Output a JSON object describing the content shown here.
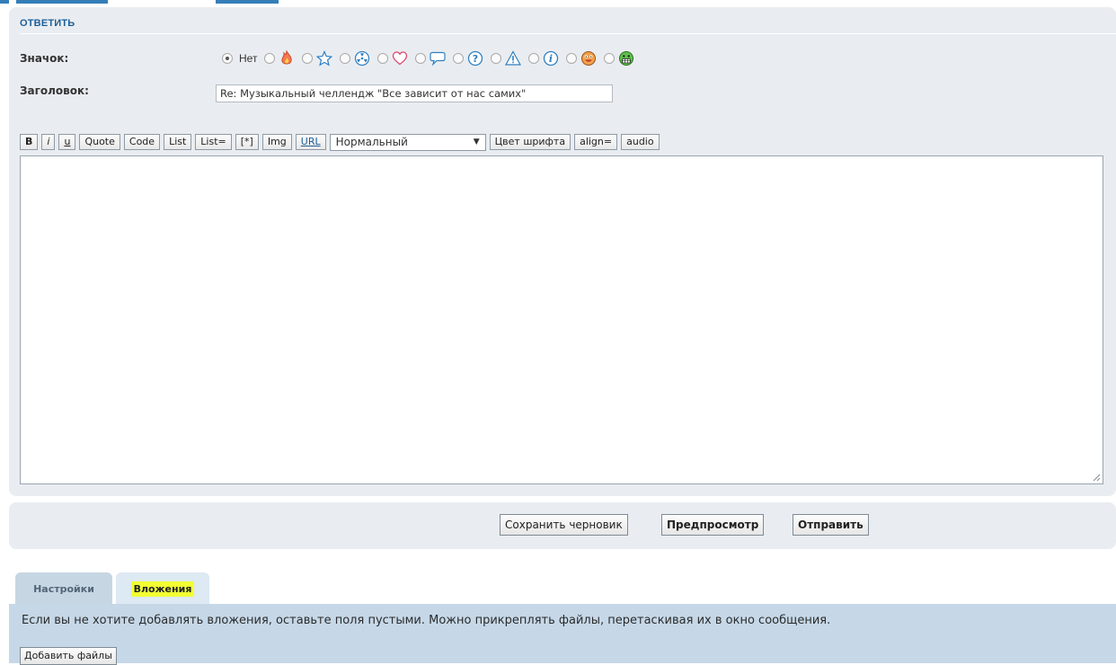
{
  "reply": {
    "title": "ОТВЕТИТЬ",
    "icon_label": "Значок:",
    "subject_label": "Заголовок:",
    "subject_value": "Re: Музыкальный челлендж \"Все зависит от нас самих\"",
    "icon_options": [
      {
        "label": "Нет",
        "icon": "none",
        "checked": true
      },
      {
        "label": "",
        "icon": "fire-icon",
        "checked": false
      },
      {
        "label": "",
        "icon": "star-icon",
        "checked": false
      },
      {
        "label": "",
        "icon": "radioactive-icon",
        "checked": false
      },
      {
        "label": "",
        "icon": "heart-icon",
        "checked": false
      },
      {
        "label": "",
        "icon": "speech-bubble-icon",
        "checked": false
      },
      {
        "label": "",
        "icon": "question-icon",
        "checked": false
      },
      {
        "label": "",
        "icon": "warning-icon",
        "checked": false
      },
      {
        "label": "",
        "icon": "info-icon",
        "checked": false
      },
      {
        "label": "",
        "icon": "smiley-icon",
        "checked": false
      },
      {
        "label": "",
        "icon": "grin-icon",
        "checked": false
      }
    ]
  },
  "toolbar": {
    "bold": "B",
    "italic": "i",
    "underline": "u",
    "quote": "Quote",
    "code": "Code",
    "list": "List",
    "list_ordered": "List=",
    "list_item": "[*]",
    "img": "Img",
    "url": "URL",
    "font_size": "Нормальный",
    "font_color": "Цвет шрифта",
    "align": "align=",
    "audio": "audio"
  },
  "actions": {
    "save_draft": "Сохранить черновик",
    "preview": "Предпросмотр",
    "submit": "Отправить"
  },
  "tabs": {
    "settings": "Настройки",
    "attachments": "Вложения"
  },
  "attachments": {
    "info": "Если вы не хотите добавлять вложения, оставьте поля пустыми. Можно прикреплять файлы, перетаскивая их в окно сообщения.",
    "add_files": "Добавить файлы"
  },
  "colors": {
    "panel_bg": "#e9edf1",
    "accent": "#1d5f98",
    "attach_bg": "#c6d8e8",
    "highlight": "#f2ff32"
  }
}
